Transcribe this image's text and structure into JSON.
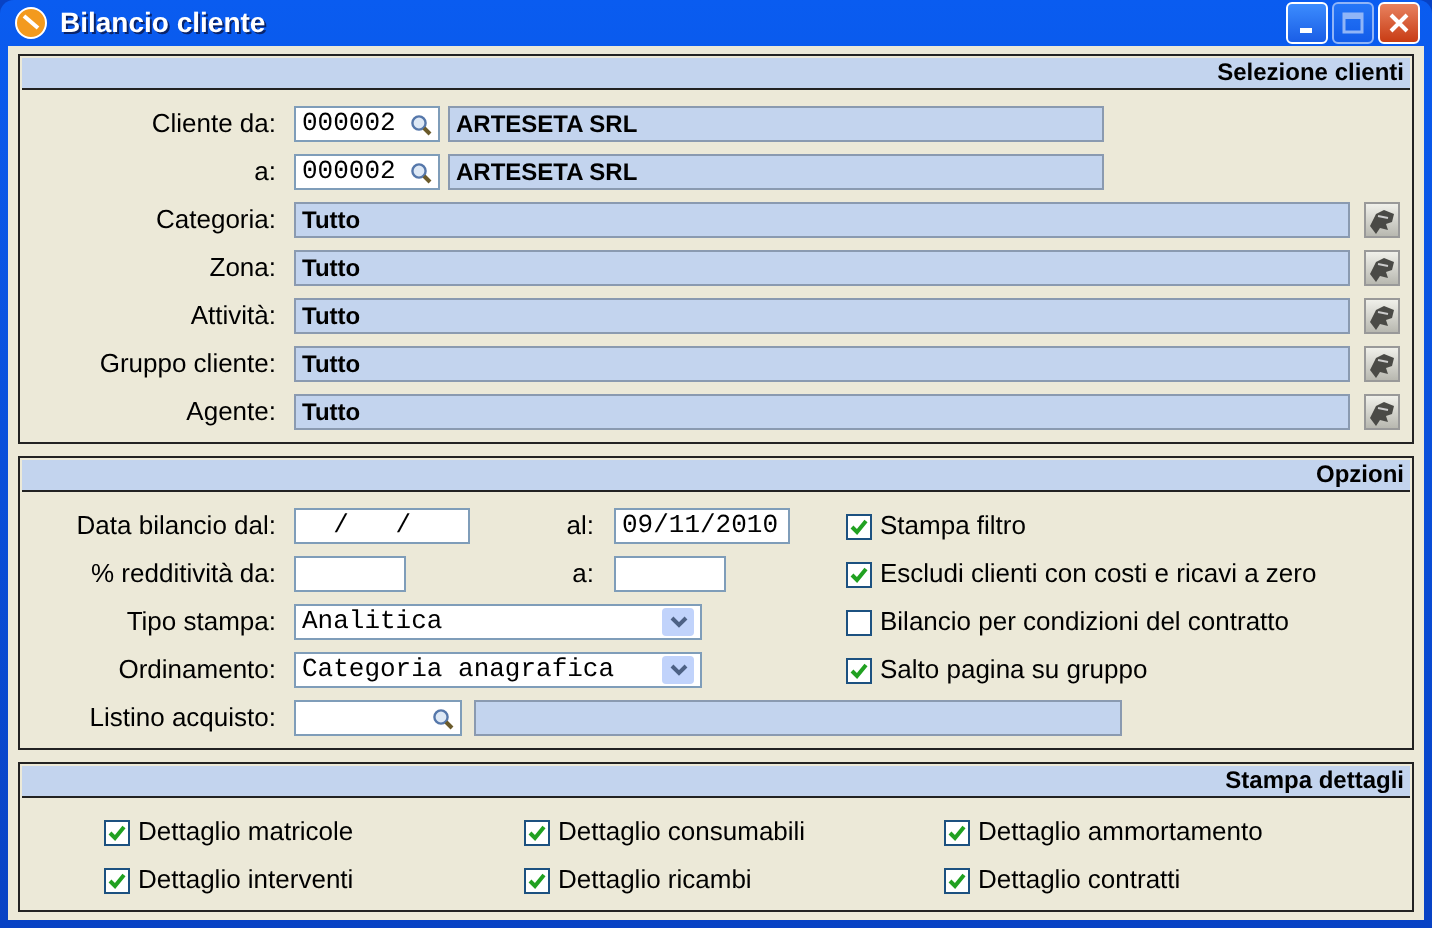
{
  "window": {
    "title": "Bilancio cliente",
    "controls": [
      {
        "kind": "minimize",
        "disabled": false
      },
      {
        "kind": "maximize",
        "disabled": true
      },
      {
        "kind": "close",
        "disabled": false
      }
    ]
  },
  "selezione": {
    "title": "Selezione clienti",
    "rows": [
      {
        "kind": "code_range",
        "label": "Cliente da:",
        "code": "000002",
        "name": "ARTESETA SRL"
      },
      {
        "kind": "code_range",
        "label": "a:",
        "code": "000002",
        "name": "ARTESETA SRL"
      },
      {
        "kind": "lookup",
        "label": "Categoria:",
        "value": "Tutto"
      },
      {
        "kind": "lookup",
        "label": "Zona:",
        "value": "Tutto"
      },
      {
        "kind": "lookup",
        "label": "Attività:",
        "value": "Tutto"
      },
      {
        "kind": "lookup",
        "label": "Gruppo cliente:",
        "value": "Tutto"
      },
      {
        "kind": "lookup",
        "label": "Agente:",
        "value": "Tutto"
      }
    ]
  },
  "opzioni": {
    "title": "Opzioni",
    "rows": [
      {
        "kind": "date_range",
        "label": "Data bilancio dal:",
        "from": "  /   /",
        "to_label": "al:",
        "to": "09/11/2010"
      },
      {
        "kind": "number_range",
        "label": "% redditività da:",
        "to_label": "a:"
      },
      {
        "kind": "select",
        "label": "Tipo stampa:",
        "value": "Analitica"
      },
      {
        "kind": "select",
        "label": "Ordinamento:",
        "value": "Categoria anagrafica"
      },
      {
        "kind": "search",
        "label": "Listino acquisto:"
      }
    ],
    "checks": [
      {
        "label": "Stampa filtro",
        "checked": true
      },
      {
        "label": "Escludi clienti con costi e ricavi a zero",
        "checked": true
      },
      {
        "label": "Bilancio per condizioni del contratto",
        "checked": false
      },
      {
        "label": "Salto pagina su gruppo",
        "checked": true
      }
    ]
  },
  "dettagli": {
    "title": "Stampa dettagli",
    "checks": [
      {
        "label": "Dettaglio matricole",
        "checked": true
      },
      {
        "label": "Dettaglio consumabili",
        "checked": true
      },
      {
        "label": "Dettaglio ammortamento",
        "checked": true
      },
      {
        "label": "Dettaglio interventi",
        "checked": true
      },
      {
        "label": "Dettaglio ricambi",
        "checked": true
      },
      {
        "label": "Dettaglio contratti",
        "checked": true
      }
    ]
  }
}
